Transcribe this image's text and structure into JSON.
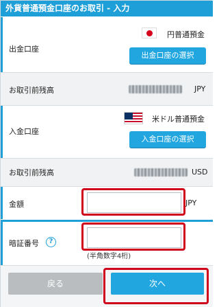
{
  "title": "外貨普通預金口座のお取引 - 入力",
  "withdrawal": {
    "label": "出金口座",
    "account_name": "円普通預金",
    "flag_icon": "japan-flag-icon",
    "select_button": "出金口座の選択",
    "balance_label": "お取引前残高",
    "balance_currency": "JPY"
  },
  "deposit": {
    "label": "入金口座",
    "account_name": "米ドル普通預金",
    "flag_icon": "us-flag-icon",
    "select_button": "入金口座の選択",
    "balance_label": "お取引前残高",
    "balance_currency": "USD"
  },
  "amount": {
    "label": "金額",
    "value": "",
    "currency": "JPY"
  },
  "pin": {
    "label": "暗証番号",
    "value": "",
    "note": "(半角数字4桁)"
  },
  "buttons": {
    "back": "戻る",
    "next": "次へ"
  },
  "colors": {
    "accent": "#1f9fd8",
    "highlight": "#d0021b"
  }
}
